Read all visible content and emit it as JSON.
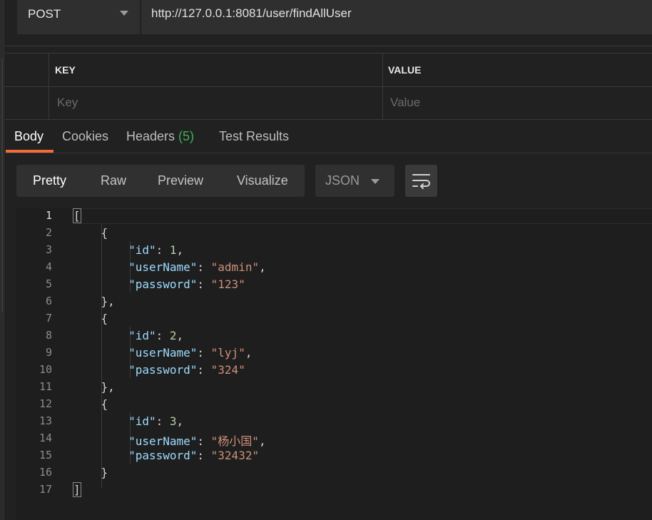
{
  "request": {
    "method": "POST",
    "url": "http://127.0.0.1:8081/user/findAllUser"
  },
  "params": {
    "headers": [
      "KEY",
      "VALUE"
    ],
    "key_placeholder": "Key",
    "value_placeholder": "Value"
  },
  "response_tabs": [
    {
      "label": "Body",
      "active": true
    },
    {
      "label": "Cookies"
    },
    {
      "label": "Headers ",
      "count": "(5)"
    },
    {
      "label": "Test Results"
    }
  ],
  "format": {
    "buttons": [
      "Pretty",
      "Raw",
      "Preview",
      "Visualize"
    ],
    "active": "Pretty",
    "language": "JSON",
    "wrap_icon": "wrap-lines-icon"
  },
  "editor": {
    "line_numbers": [
      "1",
      "2",
      "3",
      "4",
      "5",
      "6",
      "7",
      "8",
      "9",
      "10",
      "11",
      "12",
      "13",
      "14",
      "15",
      "16",
      "17"
    ],
    "lines": [
      "[",
      "    {",
      "        \"id\": 1,",
      "        \"userName\": \"admin\",",
      "        \"password\": \"123\"",
      "    },",
      "    {",
      "        \"id\": 2,",
      "        \"userName\": \"lyj\",",
      "        \"password\": \"324\"",
      "    },",
      "    {",
      "        \"id\": 3,",
      "        \"userName\": \"杨小国\",",
      "        \"password\": \"32432\"",
      "    }",
      "]"
    ]
  },
  "colors": {
    "accent": "#f26b3a",
    "count_green": "#3fae5a",
    "json_key": "#9cdcfe",
    "json_string": "#ce9178",
    "json_number": "#b5cea8"
  }
}
